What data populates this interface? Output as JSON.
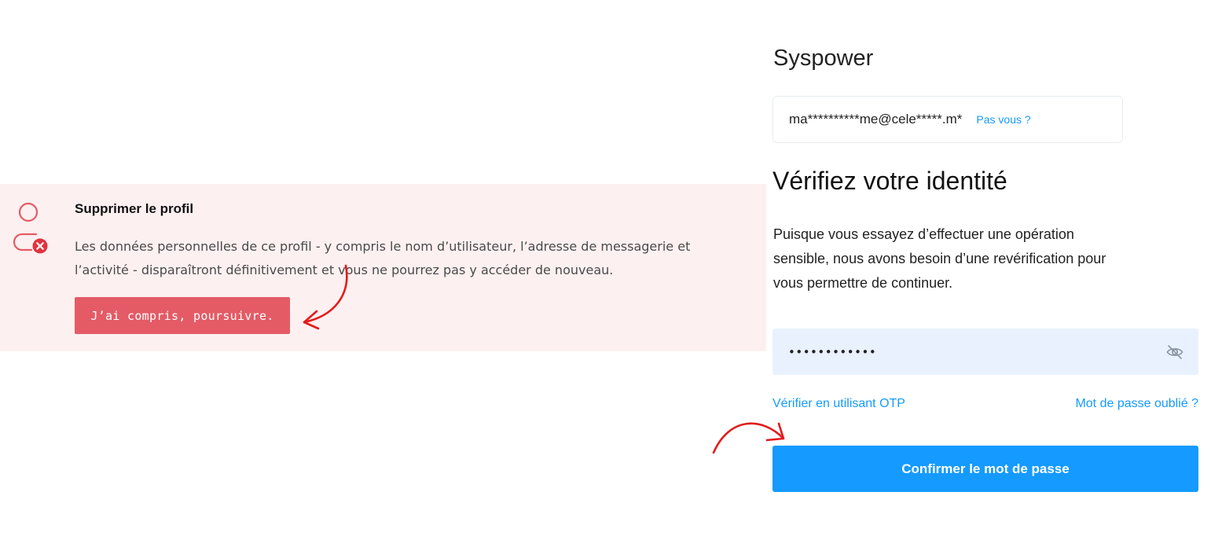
{
  "delete_profile": {
    "title": "Supprimer le profil",
    "description_line1": "Les données personnelles de ce profil - y compris le nom d’utilisateur, l’adresse de messagerie et",
    "description_line2": "l’activité - disparaîtront définitivement et vous ne pourrez pas y accéder de nouveau.",
    "confirm_button": "J’ai compris, poursuivre.",
    "icon": "user-remove-icon",
    "background_color": "#fdf0f0",
    "button_color": "#e45b66"
  },
  "verify": {
    "org_name": "Syspower",
    "masked_email": "ma**********me@cele*****.m*",
    "not_you_link": "Pas vous ?",
    "title": "Vérifiez votre identité",
    "description_line1": "Puisque vous essayez d’effectuer une opération",
    "description_line2": "sensible, nous avons besoin d’une revérification pour",
    "description_line3": "vous permettre de continuer.",
    "password_value": "••••••••••••",
    "password_toggle_icon": "eye-off-icon",
    "otp_link": "Vérifier en utilisant OTP",
    "forgot_link": "Mot de passe oublié ?",
    "confirm_button": "Confirmer le mot de passe",
    "accent_color": "#159aff",
    "field_background": "#e9f1fe"
  },
  "annotations": {
    "arrow_color": "#e21b1b"
  }
}
